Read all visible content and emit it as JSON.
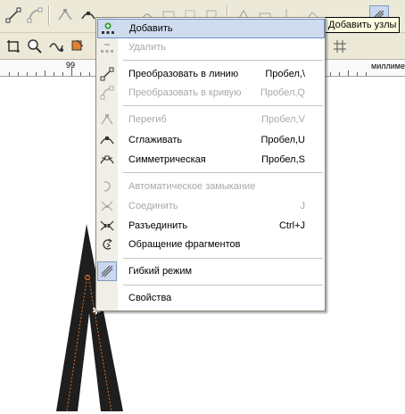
{
  "toolbar": {
    "tooltip": "Добавить узлы"
  },
  "ruler": {
    "number": "99",
    "unit": "миллиме"
  },
  "menu": {
    "items": [
      {
        "label": "Добавить",
        "shortcut": "",
        "enabled": true,
        "icon": "add-node-icon"
      },
      {
        "label": "Удалить",
        "shortcut": "",
        "enabled": false,
        "icon": "delete-node-icon"
      },
      {
        "label": "Преобразовать в линию",
        "shortcut": "Пробел,\\",
        "enabled": true,
        "icon": "to-line-icon"
      },
      {
        "label": "Преобразовать в кривую",
        "shortcut": "Пробел,Q",
        "enabled": false,
        "icon": "to-curve-icon"
      },
      {
        "label": "Перегиб",
        "shortcut": "Пробел,V",
        "enabled": false,
        "icon": "cusp-node-icon"
      },
      {
        "label": "Сглаживать",
        "shortcut": "Пробел,U",
        "enabled": true,
        "icon": "smooth-node-icon"
      },
      {
        "label": "Симметрическая",
        "shortcut": "Пробел,S",
        "enabled": true,
        "icon": "symmetric-node-icon"
      },
      {
        "label": "Автоматическое замыкание",
        "shortcut": "",
        "enabled": false,
        "icon": "auto-close-icon"
      },
      {
        "label": "Соединить",
        "shortcut": "J",
        "enabled": false,
        "icon": "join-nodes-icon"
      },
      {
        "label": "Разъединить",
        "shortcut": "Ctrl+J",
        "enabled": true,
        "icon": "break-apart-icon"
      },
      {
        "label": "Обращение фрагментов",
        "shortcut": "",
        "enabled": true,
        "icon": "reverse-direction-icon"
      },
      {
        "label": "Гибкий режим",
        "shortcut": "",
        "enabled": true,
        "icon": "elastic-mode-icon"
      },
      {
        "label": "Свойства",
        "shortcut": "",
        "enabled": true,
        "icon": ""
      }
    ]
  }
}
